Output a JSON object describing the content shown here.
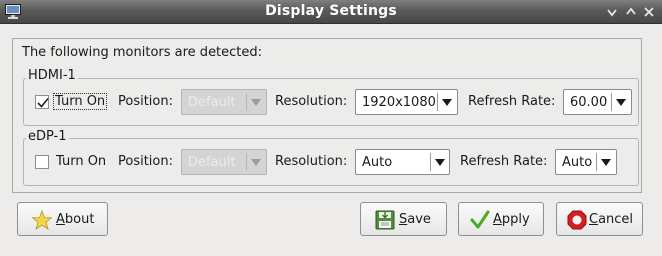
{
  "window": {
    "title": "Display Settings"
  },
  "intro_text": "The following monitors are detected:",
  "monitors": [
    {
      "name": "HDMI-1",
      "turn_on_label": "Turn On",
      "turn_on_checked": true,
      "position_label": "Position:",
      "position_value": "Default",
      "position_enabled": false,
      "resolution_label": "Resolution:",
      "resolution_value": "1920x1080",
      "refresh_label": "Refresh Rate:",
      "refresh_value": "60.00"
    },
    {
      "name": "eDP-1",
      "turn_on_label": "Turn On",
      "turn_on_checked": false,
      "position_label": "Position:",
      "position_value": "Default",
      "position_enabled": false,
      "resolution_label": "Resolution:",
      "resolution_value": "Auto",
      "refresh_label": "Refresh Rate:",
      "refresh_value": "Auto"
    }
  ],
  "buttons": {
    "about_prefix": "A",
    "about_rest": "bout",
    "save_prefix": "S",
    "save_rest": "ave",
    "apply_prefix": "A",
    "apply_rest": "pply",
    "cancel_prefix": "C",
    "cancel_rest": "ancel"
  },
  "colors": {
    "titlebar": "#5a5a5a",
    "dialog_bg": "#edeceb",
    "disabled_combo": "#d4d4d4",
    "cancel_icon": "#d42020",
    "apply_icon": "#4caa1e",
    "about_icon": "#f2d44a"
  },
  "icons": {
    "app": "monitor-icon",
    "minimize": "minimize-icon",
    "maximize": "maximize-icon",
    "close": "close-icon",
    "about": "star-icon",
    "save": "floppy-disk-icon",
    "apply": "checkmark-icon",
    "cancel": "stop-icon"
  }
}
